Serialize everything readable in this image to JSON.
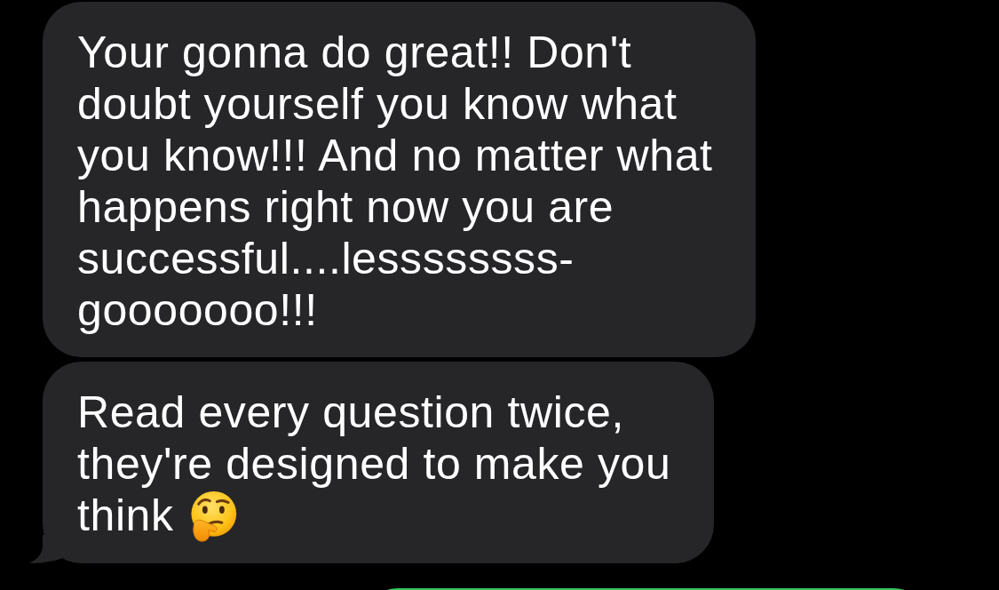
{
  "messages": [
    {
      "kind": "received",
      "text": "Your gonna do great!! Don't doubt yourself you know what you know!!! And no matter what happens right now you are successful....lessssssss-gooooooo!!!",
      "emoji": false,
      "tail": false
    },
    {
      "kind": "received",
      "text": "Read every question twice, they're designed to make you think",
      "emoji": true,
      "tail": true
    },
    {
      "kind": "sent"
    }
  ]
}
